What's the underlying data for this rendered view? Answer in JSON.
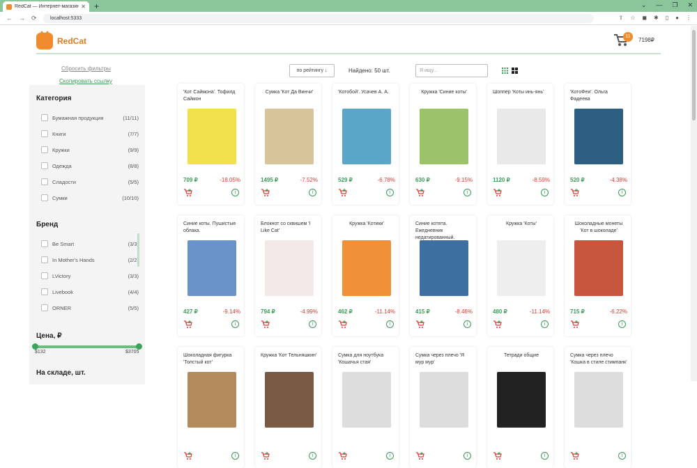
{
  "browser": {
    "tab_title": "RedCat — Интернет-магазин д...",
    "url": "localhost:5333"
  },
  "header": {
    "brand": "RedCat",
    "cart_count": "11",
    "balance": "7198₽"
  },
  "filters": {
    "reset": "Сбросить фильтры",
    "copy_link": "Скопировать ссылку",
    "category_title": "Категория",
    "categories": [
      {
        "label": "Бумажная продукция",
        "count": "(11/11)"
      },
      {
        "label": "Книги",
        "count": "(7/7)"
      },
      {
        "label": "Кружки",
        "count": "(9/9)"
      },
      {
        "label": "Одежда",
        "count": "(8/8)"
      },
      {
        "label": "Сладости",
        "count": "(5/5)"
      },
      {
        "label": "Сумки",
        "count": "(10/10)"
      }
    ],
    "brand_title": "Бренд",
    "brands": [
      {
        "label": "Be Smart",
        "count": "(3/3)"
      },
      {
        "label": "In Mother's Hands",
        "count": "(2/2)"
      },
      {
        "label": "LVictory",
        "count": "(3/3)"
      },
      {
        "label": "Livebook",
        "count": "(4/4)"
      },
      {
        "label": "ORNER",
        "count": "(5/5)"
      }
    ],
    "price_title": "Цена, ₽",
    "price_min": "$132",
    "price_max": "$3705",
    "stock_title": "На складе, шт."
  },
  "toolbar": {
    "sort": "по рейтингу ↓",
    "found": "Найдено: 50 шт.",
    "search_placeholder": "Я ищу..."
  },
  "products": [
    {
      "name": "'Кот Саймона'. Тофилд Саймон",
      "price": "709 ₽",
      "discount": "-18.05%",
      "color": "#f2e14a"
    },
    {
      "name": "Сумка 'Кот Да Винчи'",
      "price": "1495 ₽",
      "discount": "-7.52%",
      "color": "#d8c49a"
    },
    {
      "name": "'Котобой'. Усачев А. А.",
      "price": "529 ₽",
      "discount": "-6.78%",
      "color": "#5aa6c9"
    },
    {
      "name": "Кружка 'Синие коты'",
      "price": "630 ₽",
      "discount": "-9.15%",
      "color": "#9cc26a"
    },
    {
      "name": "Шоппер 'Коты инь-янь'",
      "price": "1120 ₽",
      "discount": "-8.59%",
      "color": "#e9e9e9"
    },
    {
      "name": "'КотоФеи'. Ольга Фадеева",
      "price": "520 ₽",
      "discount": "-4.38%",
      "color": "#2d5f82"
    },
    {
      "name": "Синие коты. Пушистые облака.",
      "price": "427 ₽",
      "discount": "-9.14%",
      "color": "#6a93c9"
    },
    {
      "name": "Блокнот со сквишем 'I Like Cat'",
      "price": "794 ₽",
      "discount": "-4.99%",
      "color": "#f2e8e6"
    },
    {
      "name": "Кружка 'Котики'",
      "price": "462 ₽",
      "discount": "-11.14%",
      "color": "#f0913a"
    },
    {
      "name": "Синие котята. Ежедневник недатированный.",
      "price": "415 ₽",
      "discount": "-8.46%",
      "color": "#3d6fa0"
    },
    {
      "name": "Кружка 'Коты'",
      "price": "480 ₽",
      "discount": "-11.14%",
      "color": "#eeeeee"
    },
    {
      "name": "Шоколадные монеты 'Кот в шоколаде'",
      "price": "715 ₽",
      "discount": "-6.22%",
      "color": "#c8553d"
    },
    {
      "name": "Шоколадная фигурка 'Толстый кот'",
      "price": "",
      "discount": "",
      "color": "#b38a5b"
    },
    {
      "name": "Кружка 'Кот Тельняшкин'",
      "price": "",
      "discount": "",
      "color": "#7a5a44"
    },
    {
      "name": "Сумка для ноутбука 'Кошачья стая'",
      "price": "",
      "discount": "",
      "color": "#dddddd"
    },
    {
      "name": "Сумка через плечо 'Я мур мур'",
      "price": "",
      "discount": "",
      "color": "#dddddd"
    },
    {
      "name": "Тетради общие",
      "price": "",
      "discount": "",
      "color": "#222222"
    },
    {
      "name": "Сумка через плечо 'Кошка в стиле стимпанк'",
      "price": "",
      "discount": "",
      "color": "#dddddd"
    }
  ]
}
